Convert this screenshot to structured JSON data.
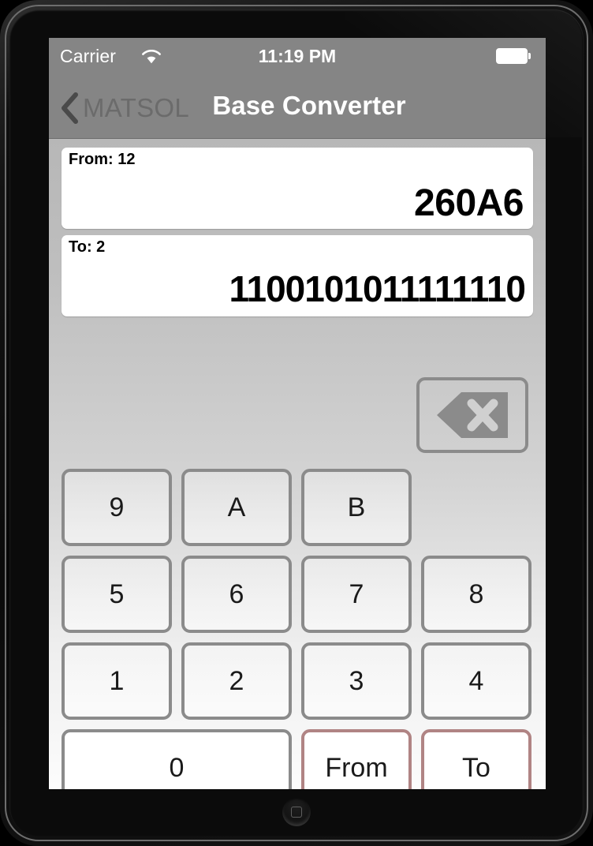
{
  "status_bar": {
    "carrier": "Carrier",
    "wifi_icon": "wifi-icon",
    "time": "11:19 PM",
    "battery_icon": "battery-full-icon"
  },
  "nav_bar": {
    "back_icon": "chevron-left-icon",
    "back_label": "MATSOL",
    "title": "Base Converter"
  },
  "display": {
    "from": {
      "label": "From: 12",
      "value": "260A6",
      "base": "12"
    },
    "to": {
      "label": "To: 2",
      "value": "1100101011111110",
      "base": "2"
    }
  },
  "backspace": {
    "icon": "backspace-delete-icon",
    "label": ""
  },
  "keypad": {
    "rows": [
      [
        {
          "label": "9",
          "kind": "digit"
        },
        {
          "label": "A",
          "kind": "digit"
        },
        {
          "label": "B",
          "kind": "digit"
        },
        {
          "label": "",
          "kind": "empty"
        }
      ],
      [
        {
          "label": "5",
          "kind": "digit"
        },
        {
          "label": "6",
          "kind": "digit"
        },
        {
          "label": "7",
          "kind": "digit"
        },
        {
          "label": "8",
          "kind": "digit"
        }
      ],
      [
        {
          "label": "1",
          "kind": "digit"
        },
        {
          "label": "2",
          "kind": "digit"
        },
        {
          "label": "3",
          "kind": "digit"
        },
        {
          "label": "4",
          "kind": "digit"
        }
      ],
      [
        {
          "label": "0",
          "kind": "wide"
        },
        {
          "label": "From",
          "kind": "accent"
        },
        {
          "label": "To",
          "kind": "accent"
        }
      ]
    ]
  },
  "colors": {
    "bar_gray": "#858585",
    "back_label_gray": "#6b6b6b",
    "key_border": "#8b8b8b",
    "accent_border": "#b08484",
    "keypad_bg_top": "#b7b7b7",
    "keypad_bg_bottom": "#fcfcfc",
    "field_bg": "#ffffff",
    "text_black": "#000000"
  },
  "device": {
    "home_button": "home-button"
  }
}
